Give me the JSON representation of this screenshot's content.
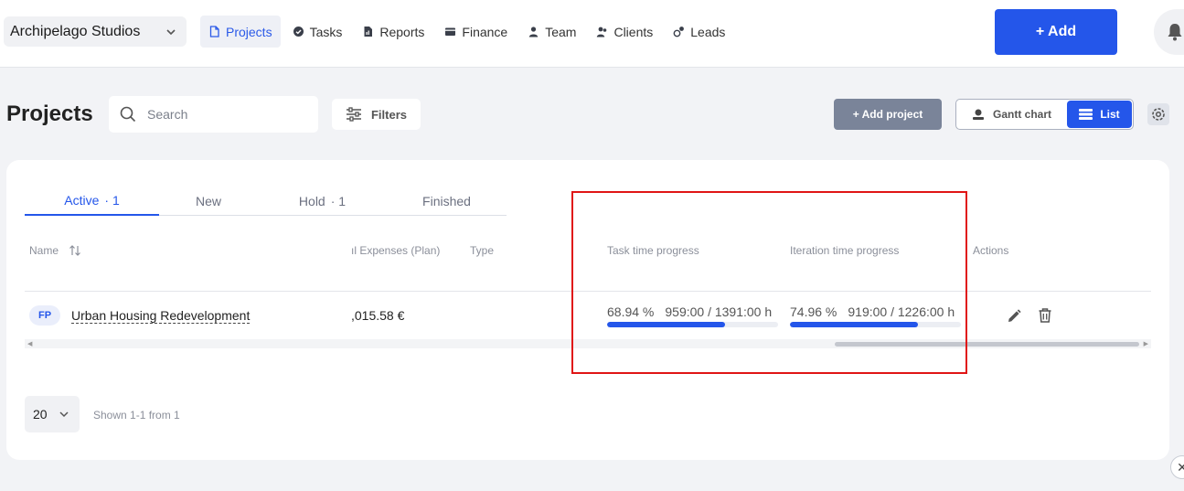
{
  "workspace": {
    "name": "Archipelago Studios"
  },
  "nav": [
    {
      "label": "Projects",
      "icon": "document-icon",
      "active": true
    },
    {
      "label": "Tasks",
      "icon": "check-circle-icon"
    },
    {
      "label": "Reports",
      "icon": "report-icon"
    },
    {
      "label": "Finance",
      "icon": "wallet-icon"
    },
    {
      "label": "Team",
      "icon": "person-icon"
    },
    {
      "label": "Clients",
      "icon": "people-icon"
    },
    {
      "label": "Leads",
      "icon": "leads-icon"
    }
  ],
  "header": {
    "add_label": "+ Add"
  },
  "toolbar": {
    "title": "Projects",
    "search_placeholder": "Search",
    "filters_label": "Filters",
    "add_project_label": "+ Add project",
    "gantt_label": "Gantt chart",
    "list_label": "List"
  },
  "tabs": [
    {
      "label": "Active",
      "count": "· 1",
      "active": true
    },
    {
      "label": "New",
      "count": ""
    },
    {
      "label": "Hold",
      "count": "· 1"
    },
    {
      "label": "Finished",
      "count": ""
    }
  ],
  "table": {
    "columns": {
      "name": "Name",
      "expenses": "ıl Expenses (Plan)",
      "type": "Type",
      "task_progress": "Task time progress",
      "iteration_progress": "Iteration time progress",
      "actions": "Actions"
    },
    "rows": [
      {
        "badge": "FP",
        "name": "Urban Housing Redevelopment",
        "expenses": ",015.58 €",
        "type": "",
        "task_percent": "68.94 %",
        "task_fraction": "959:00 / 1391:00 h",
        "task_ratio": 0.6894,
        "iteration_percent": "74.96 %",
        "iteration_fraction": "919:00 / 1226:00 h",
        "iteration_ratio": 0.7496
      }
    ]
  },
  "pagination": {
    "page_size": "20",
    "info": "Shown 1-1 from 1"
  },
  "colors": {
    "accent": "#2456ea",
    "highlight": "#e01515",
    "muted_button": "#7a8499"
  }
}
